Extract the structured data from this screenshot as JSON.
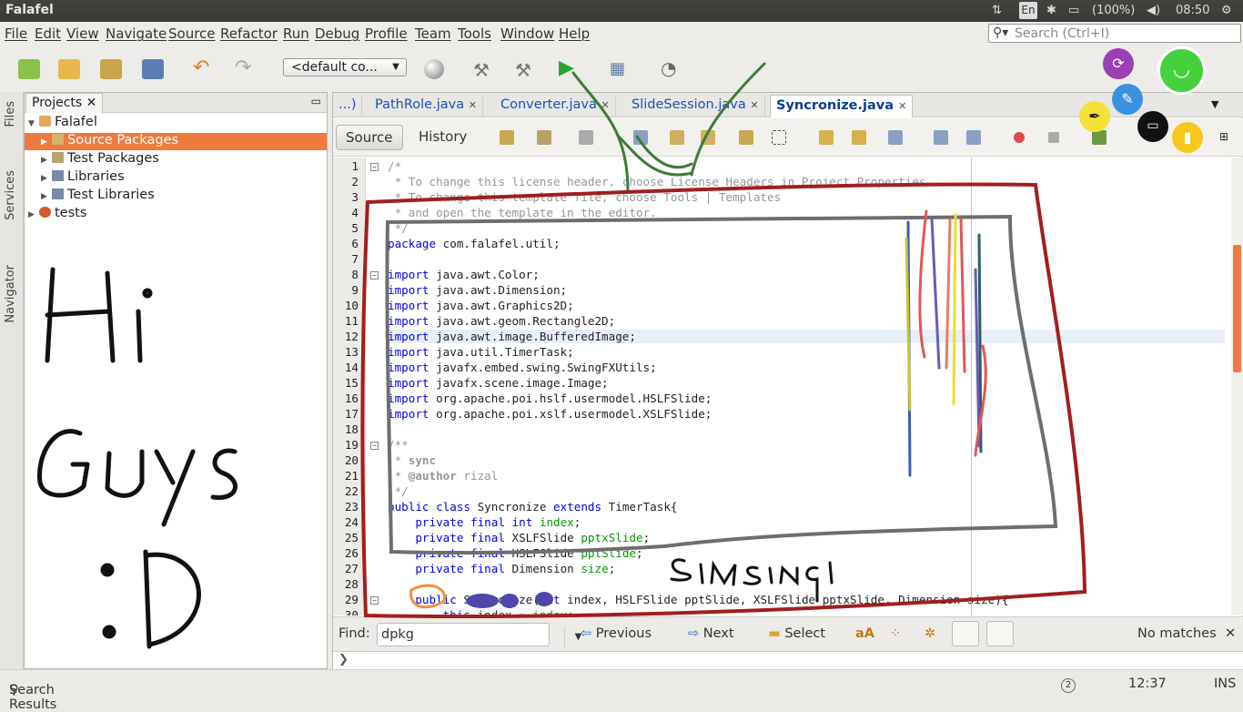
{
  "window": {
    "title": "Falafel"
  },
  "indicators": {
    "lang": "En",
    "battery": "(100%)",
    "time": "08:50"
  },
  "menu": [
    "File",
    "Edit",
    "View",
    "Navigate",
    "Source",
    "Refactor",
    "Run",
    "Debug",
    "Profile",
    "Team",
    "Tools",
    "Window",
    "Help"
  ],
  "search": {
    "placeholder": "Search (Ctrl+I)"
  },
  "toolbar": {
    "config": "<default co..."
  },
  "sidetabs": [
    "Files",
    "Services",
    "Navigator"
  ],
  "projects": {
    "tab": "Projects",
    "items": [
      {
        "label": "Falafel",
        "level": 0
      },
      {
        "label": "Source Packages",
        "level": 1,
        "selected": true
      },
      {
        "label": "Test Packages",
        "level": 1
      },
      {
        "label": "Libraries",
        "level": 1
      },
      {
        "label": "Test Libraries",
        "level": 1
      },
      {
        "label": "tests",
        "level": 0
      }
    ]
  },
  "editor": {
    "tabs": [
      "...)",
      "PathRole.java",
      "Converter.java",
      "SlideSession.java",
      "Syncronize.java"
    ],
    "source_btn": "Source",
    "history_btn": "History",
    "lines": [
      {
        "n": "1",
        "t": "/*"
      },
      {
        "n": "2",
        "t": " * To change this license header, choose License Headers in Project Properties."
      },
      {
        "n": "3",
        "t": " * To change this template file, choose Tools | Templates"
      },
      {
        "n": "4",
        "t": " * and open the template in the editor."
      },
      {
        "n": "5",
        "t": " */"
      },
      {
        "n": "6",
        "t": "package com.falafel.util;"
      },
      {
        "n": "7",
        "t": ""
      },
      {
        "n": "8",
        "t": "import java.awt.Color;"
      },
      {
        "n": "9",
        "t": "import java.awt.Dimension;"
      },
      {
        "n": "10",
        "t": "import java.awt.Graphics2D;"
      },
      {
        "n": "11",
        "t": "import java.awt.geom.Rectangle2D;"
      },
      {
        "n": "12",
        "t": "import java.awt.image.BufferedImage;"
      },
      {
        "n": "13",
        "t": "import java.util.TimerTask;"
      },
      {
        "n": "14",
        "t": "import javafx.embed.swing.SwingFXUtils;"
      },
      {
        "n": "15",
        "t": "import javafx.scene.image.Image;"
      },
      {
        "n": "16",
        "t": "import org.apache.poi.hslf.usermodel.HSLFSlide;"
      },
      {
        "n": "17",
        "t": "import org.apache.poi.xslf.usermodel.XSLFSlide;"
      },
      {
        "n": "18",
        "t": ""
      },
      {
        "n": "19",
        "t": "/**"
      },
      {
        "n": "20",
        "t": " * sync"
      },
      {
        "n": "21",
        "t": " * @author rizal"
      },
      {
        "n": "22",
        "t": " */"
      },
      {
        "n": "23",
        "t": "public class Syncronize extends TimerTask{"
      },
      {
        "n": "24",
        "t": "    private final int index;"
      },
      {
        "n": "25",
        "t": "    private final XSLFSlide pptxSlide;"
      },
      {
        "n": "26",
        "t": "    private final HSLFSlide pptSlide;"
      },
      {
        "n": "27",
        "t": "    private final Dimension size;"
      },
      {
        "n": "28",
        "t": ""
      },
      {
        "n": "29",
        "t": "    public Syncronize(int index, HSLFSlide pptSlide, XSLFSlide pptxSlide, Dimension size){"
      },
      {
        "n": "30",
        "t": "        this.index = index;"
      }
    ]
  },
  "find": {
    "label": "Find:",
    "value": "dpkg",
    "previous": "Previous",
    "next": "Next",
    "select": "Select",
    "status": "No matches"
  },
  "status": {
    "results": "Search Results",
    "notif": "2",
    "pos": "12:37",
    "mode": "INS"
  },
  "handwriting": {
    "left1": "Hi",
    "left2": "Guys",
    "left3": ":D",
    "editor": "simsingi"
  }
}
